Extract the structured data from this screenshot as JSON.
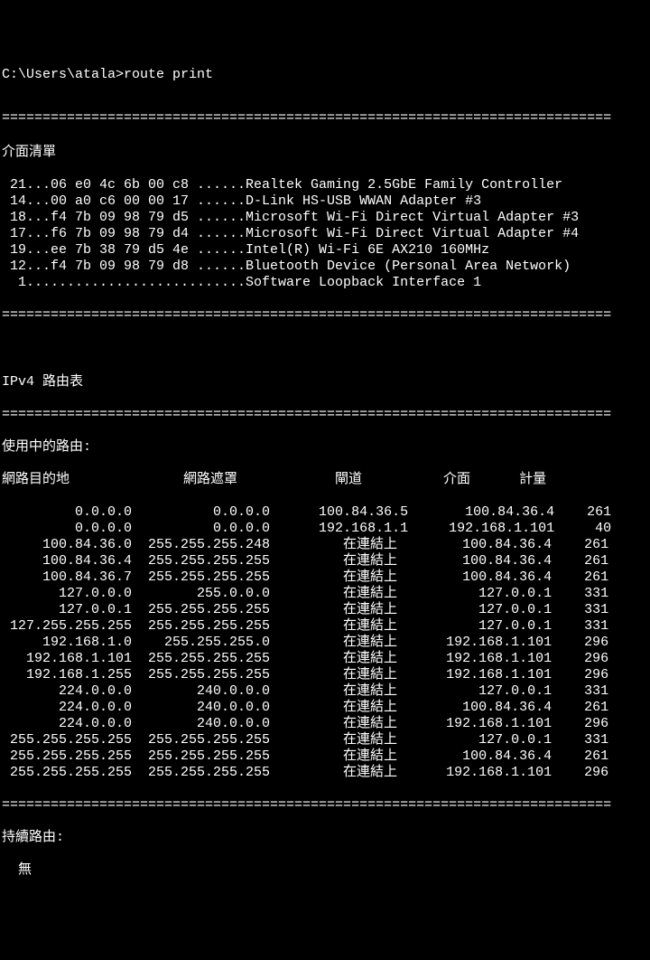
{
  "prompt": "C:\\Users\\atala>route print",
  "separator": "===========================================================================",
  "interface_list_header": "介面清單",
  "interfaces": [
    " 21...06 e0 4c 6b 00 c8 ......Realtek Gaming 2.5GbE Family Controller",
    " 14...00 a0 c6 00 00 17 ......D-Link HS-USB WWAN Adapter #3",
    " 18...f4 7b 09 98 79 d5 ......Microsoft Wi-Fi Direct Virtual Adapter #3",
    " 17...f6 7b 09 98 79 d4 ......Microsoft Wi-Fi Direct Virtual Adapter #4",
    " 19...ee 7b 38 79 d5 4e ......Intel(R) Wi-Fi 6E AX210 160MHz",
    " 12...f4 7b 09 98 79 d8 ......Bluetooth Device (Personal Area Network)",
    "  1...........................Software Loopback Interface 1"
  ],
  "ipv4_header": "IPv4 路由表",
  "active_routes_header": "使用中的路由:",
  "columns": {
    "dest": "網路目的地",
    "mask": "網路遮罩",
    "gateway": "閘道",
    "interface": "介面",
    "metric": "計量"
  },
  "routes": [
    {
      "dest": "0.0.0.0",
      "mask": "0.0.0.0",
      "gateway": "100.84.36.5",
      "interface": "100.84.36.4",
      "metric": "261"
    },
    {
      "dest": "0.0.0.0",
      "mask": "0.0.0.0",
      "gateway": "192.168.1.1",
      "interface": "192.168.1.101",
      "metric": "40"
    },
    {
      "dest": "100.84.36.0",
      "mask": "255.255.255.248",
      "gateway": "在連結上",
      "interface": "100.84.36.4",
      "metric": "261"
    },
    {
      "dest": "100.84.36.4",
      "mask": "255.255.255.255",
      "gateway": "在連結上",
      "interface": "100.84.36.4",
      "metric": "261"
    },
    {
      "dest": "100.84.36.7",
      "mask": "255.255.255.255",
      "gateway": "在連結上",
      "interface": "100.84.36.4",
      "metric": "261"
    },
    {
      "dest": "127.0.0.0",
      "mask": "255.0.0.0",
      "gateway": "在連結上",
      "interface": "127.0.0.1",
      "metric": "331"
    },
    {
      "dest": "127.0.0.1",
      "mask": "255.255.255.255",
      "gateway": "在連結上",
      "interface": "127.0.0.1",
      "metric": "331"
    },
    {
      "dest": "127.255.255.255",
      "mask": "255.255.255.255",
      "gateway": "在連結上",
      "interface": "127.0.0.1",
      "metric": "331"
    },
    {
      "dest": "192.168.1.0",
      "mask": "255.255.255.0",
      "gateway": "在連結上",
      "interface": "192.168.1.101",
      "metric": "296"
    },
    {
      "dest": "192.168.1.101",
      "mask": "255.255.255.255",
      "gateway": "在連結上",
      "interface": "192.168.1.101",
      "metric": "296"
    },
    {
      "dest": "192.168.1.255",
      "mask": "255.255.255.255",
      "gateway": "在連結上",
      "interface": "192.168.1.101",
      "metric": "296"
    },
    {
      "dest": "224.0.0.0",
      "mask": "240.0.0.0",
      "gateway": "在連結上",
      "interface": "127.0.0.1",
      "metric": "331"
    },
    {
      "dest": "224.0.0.0",
      "mask": "240.0.0.0",
      "gateway": "在連結上",
      "interface": "100.84.36.4",
      "metric": "261"
    },
    {
      "dest": "224.0.0.0",
      "mask": "240.0.0.0",
      "gateway": "在連結上",
      "interface": "192.168.1.101",
      "metric": "296"
    },
    {
      "dest": "255.255.255.255",
      "mask": "255.255.255.255",
      "gateway": "在連結上",
      "interface": "127.0.0.1",
      "metric": "331"
    },
    {
      "dest": "255.255.255.255",
      "mask": "255.255.255.255",
      "gateway": "在連結上",
      "interface": "100.84.36.4",
      "metric": "261"
    },
    {
      "dest": "255.255.255.255",
      "mask": "255.255.255.255",
      "gateway": "在連結上",
      "interface": "192.168.1.101",
      "metric": "296"
    }
  ],
  "persistent_header": "持續路由:",
  "persistent_none": "  無"
}
